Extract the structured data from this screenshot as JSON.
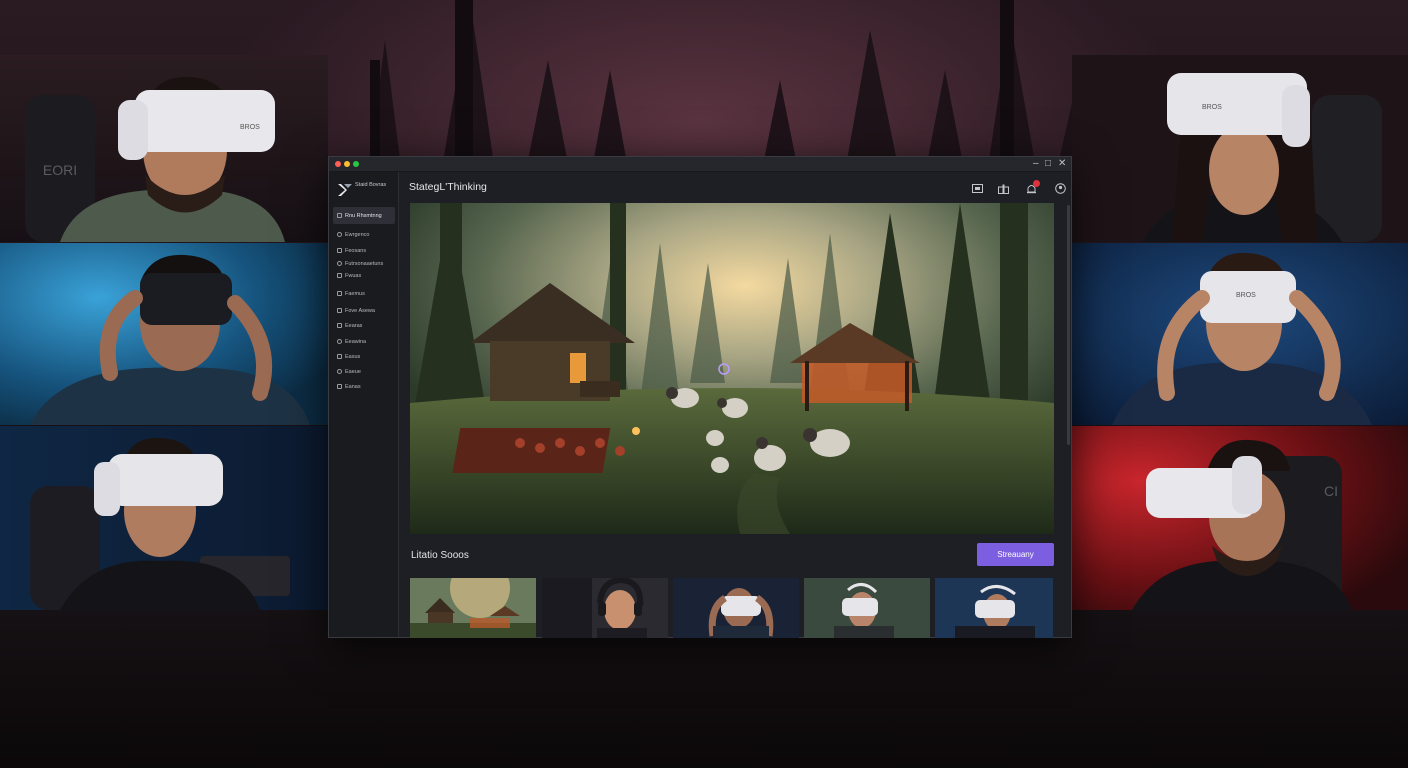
{
  "app": {
    "logo_text": "Staid Bovras",
    "title": "StategL'Thinking",
    "window_controls": [
      "–",
      "□",
      "✕"
    ]
  },
  "sidebar": {
    "items": [
      {
        "label": "Rnu Rhsmtnng",
        "icon": "people-icon",
        "active": true
      },
      {
        "label": "Ewrgenco",
        "icon": "circle-icon"
      },
      {
        "label": "Feosans",
        "icon": "grid-icon"
      },
      {
        "label": "Futrsonaaetuns",
        "icon": "globe-icon"
      },
      {
        "label": "Fwuas",
        "icon": "chat-icon"
      },
      {
        "label": "Faemus",
        "icon": "list-icon"
      },
      {
        "label": "Fove Asewa",
        "icon": "star-icon"
      },
      {
        "label": "Eearas",
        "icon": "folder-icon"
      },
      {
        "label": "Eeawina",
        "icon": "settings-icon"
      },
      {
        "label": "Easus",
        "icon": "shield-icon"
      },
      {
        "label": "Eaeue",
        "icon": "user-icon"
      },
      {
        "label": "Eanas",
        "icon": "help-icon"
      }
    ]
  },
  "topbar": {
    "icons": [
      "screen-icon",
      "gift-icon",
      "notification-icon",
      "profile-icon"
    ],
    "notification_color": "#e0323c"
  },
  "section": {
    "title": "Litatio Sooos",
    "button_label": "Streauany"
  },
  "colors": {
    "accent": "#7c5fe0",
    "window_bg": "#1e1f24",
    "sidebar_bg": "#1a1b1f"
  },
  "players": [
    {
      "headset_label": "BROS",
      "chair_label": "EORI"
    },
    {
      "headset_label": ""
    },
    {
      "headset_label": ""
    },
    {
      "headset_label": "BROS"
    },
    {
      "headset_label": "BROS"
    },
    {
      "headset_label": "",
      "chair_label": "CI"
    }
  ]
}
